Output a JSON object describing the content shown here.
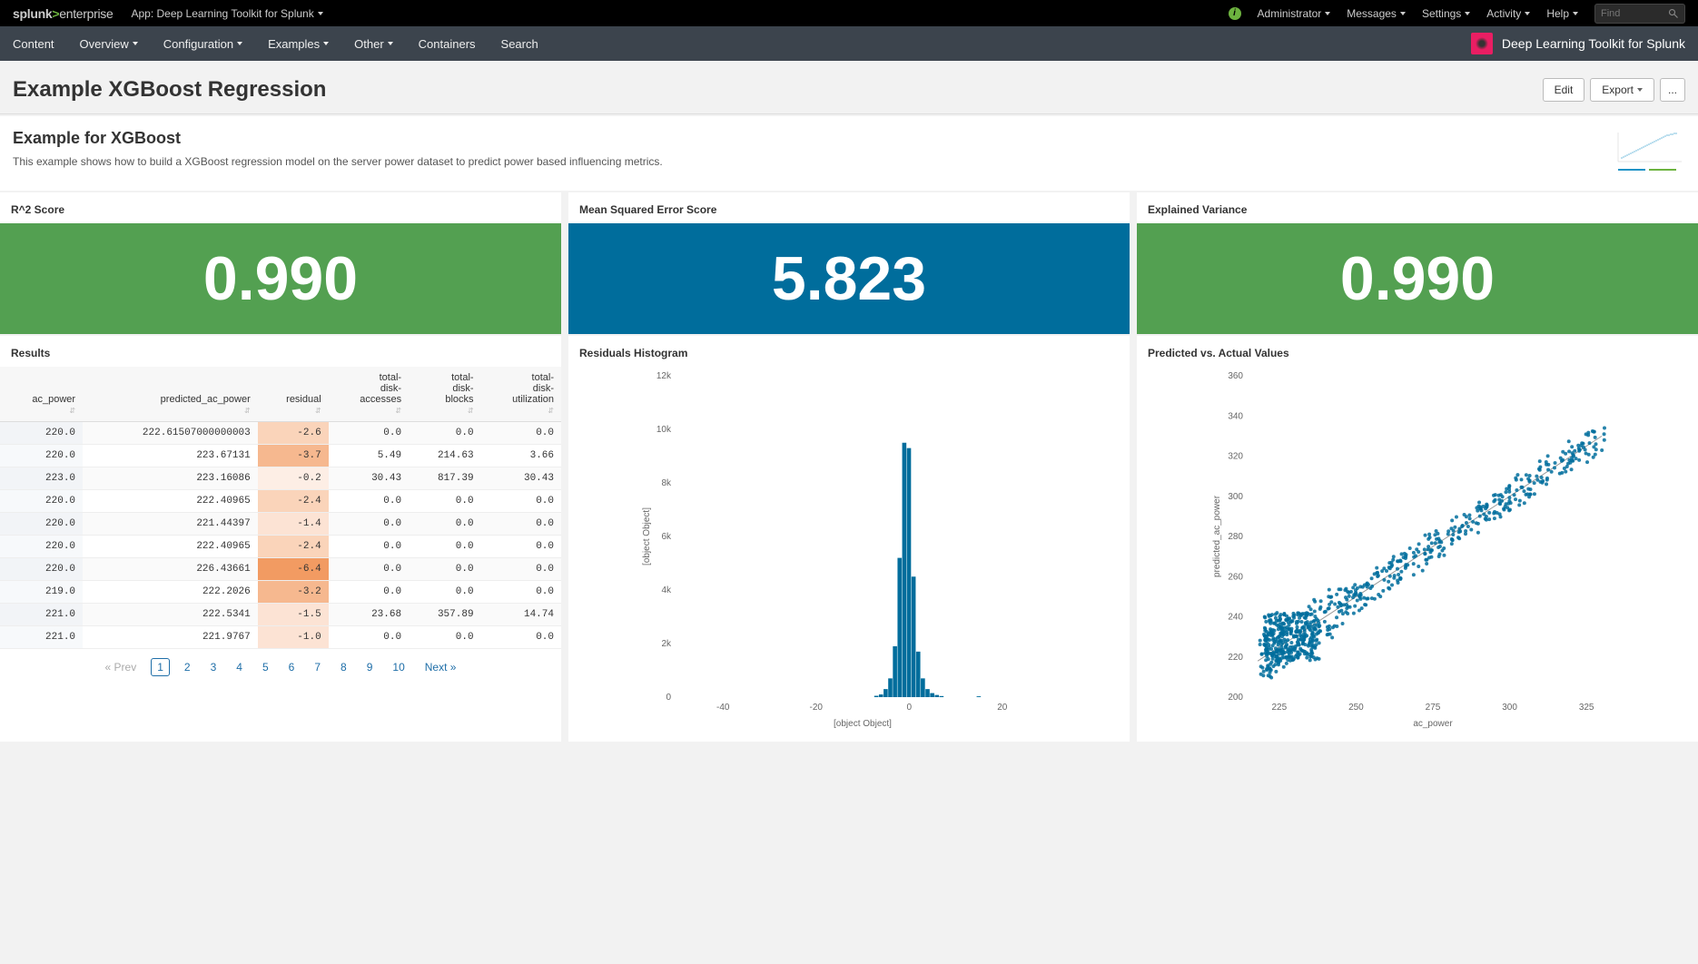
{
  "topbar": {
    "logo_prefix": "splunk",
    "logo_suffix": "enterprise",
    "app_label": "App: Deep Learning Toolkit for Splunk",
    "links": {
      "admin": "Administrator",
      "messages": "Messages",
      "settings": "Settings",
      "activity": "Activity",
      "help": "Help"
    },
    "find_placeholder": "Find"
  },
  "navbar": {
    "items": [
      "Content",
      "Overview",
      "Configuration",
      "Examples",
      "Other",
      "Containers",
      "Search"
    ],
    "app_name": "Deep Learning Toolkit for Splunk"
  },
  "title": {
    "page_title": "Example XGBoost Regression",
    "edit": "Edit",
    "export": "Export",
    "more": "..."
  },
  "intro": {
    "heading": "Example for XGBoost",
    "text": "This example shows how to build a XGBoost regression model on the server power dataset to predict power based influencing metrics."
  },
  "metrics": {
    "r2_label": "R^2 Score",
    "r2_value": "0.990",
    "mse_label": "Mean Squared Error Score",
    "mse_value": "5.823",
    "ev_label": "Explained Variance",
    "ev_value": "0.990"
  },
  "results": {
    "label": "Results",
    "columns": [
      "ac_power",
      "predicted_ac_power",
      "residual",
      "total-disk-accesses",
      "total-disk-blocks",
      "total-disk-utilization"
    ],
    "rows": [
      [
        "220.0",
        "222.61507000000003",
        "-2.6",
        "0.0",
        "0.0",
        "0.0"
      ],
      [
        "220.0",
        "223.67131",
        "-3.7",
        "5.49",
        "214.63",
        "3.66"
      ],
      [
        "223.0",
        "223.16086",
        "-0.2",
        "30.43",
        "817.39",
        "30.43"
      ],
      [
        "220.0",
        "222.40965",
        "-2.4",
        "0.0",
        "0.0",
        "0.0"
      ],
      [
        "220.0",
        "221.44397",
        "-1.4",
        "0.0",
        "0.0",
        "0.0"
      ],
      [
        "220.0",
        "222.40965",
        "-2.4",
        "0.0",
        "0.0",
        "0.0"
      ],
      [
        "220.0",
        "226.43661",
        "-6.4",
        "0.0",
        "0.0",
        "0.0"
      ],
      [
        "219.0",
        "222.2026",
        "-3.2",
        "0.0",
        "0.0",
        "0.0"
      ],
      [
        "221.0",
        "222.5341",
        "-1.5",
        "23.68",
        "357.89",
        "14.74"
      ],
      [
        "221.0",
        "221.9767",
        "-1.0",
        "0.0",
        "0.0",
        "0.0"
      ]
    ],
    "residual_shade": [
      3,
      4,
      1,
      3,
      2,
      3,
      5,
      4,
      2,
      2
    ],
    "pager": {
      "prev": "« Prev",
      "next": "Next »",
      "pages": [
        "1",
        "2",
        "3",
        "4",
        "5",
        "6",
        "7",
        "8",
        "9",
        "10"
      ]
    }
  },
  "hist": {
    "label": "Residuals Histogram",
    "xlabel": "[object Object]",
    "ylabel": "[object Object]"
  },
  "scatter": {
    "label": "Predicted vs. Actual Values",
    "xlabel": "ac_power",
    "ylabel": "predicted_ac_power"
  },
  "chart_data": [
    {
      "type": "bar",
      "title": "Residuals Histogram",
      "xlabel": "[object Object]",
      "ylabel": "[object Object]",
      "xlim": [
        -50,
        30
      ],
      "ylim": [
        0,
        12000
      ],
      "yticks": [
        0,
        2000,
        4000,
        6000,
        8000,
        10000,
        12000
      ],
      "xticks": [
        -40,
        -20,
        0,
        20
      ],
      "bins": [
        {
          "x": -7,
          "count": 50
        },
        {
          "x": -6,
          "count": 100
        },
        {
          "x": -5,
          "count": 300
        },
        {
          "x": -4,
          "count": 700
        },
        {
          "x": -3,
          "count": 1900
        },
        {
          "x": -2,
          "count": 5200
        },
        {
          "x": -1,
          "count": 9500
        },
        {
          "x": 0,
          "count": 9300
        },
        {
          "x": 1,
          "count": 4500
        },
        {
          "x": 2,
          "count": 1700
        },
        {
          "x": 3,
          "count": 700
        },
        {
          "x": 4,
          "count": 300
        },
        {
          "x": 5,
          "count": 150
        },
        {
          "x": 6,
          "count": 80
        },
        {
          "x": 7,
          "count": 40
        },
        {
          "x": 15,
          "count": 30
        }
      ]
    },
    {
      "type": "scatter",
      "title": "Predicted vs. Actual Values",
      "xlabel": "ac_power",
      "ylabel": "predicted_ac_power",
      "xlim": [
        215,
        335
      ],
      "ylim": [
        200,
        360
      ],
      "xticks": [
        225,
        250,
        275,
        300,
        325
      ],
      "yticks": [
        200,
        220,
        240,
        260,
        280,
        300,
        320,
        340,
        360
      ],
      "reference_line": {
        "x0": 218,
        "y0": 218,
        "x1": 330,
        "y1": 330
      },
      "note": "Dense cloud of ~500 points roughly along y=x diagonal; heaviest density in 220-250 range; some vertical banding."
    }
  ]
}
